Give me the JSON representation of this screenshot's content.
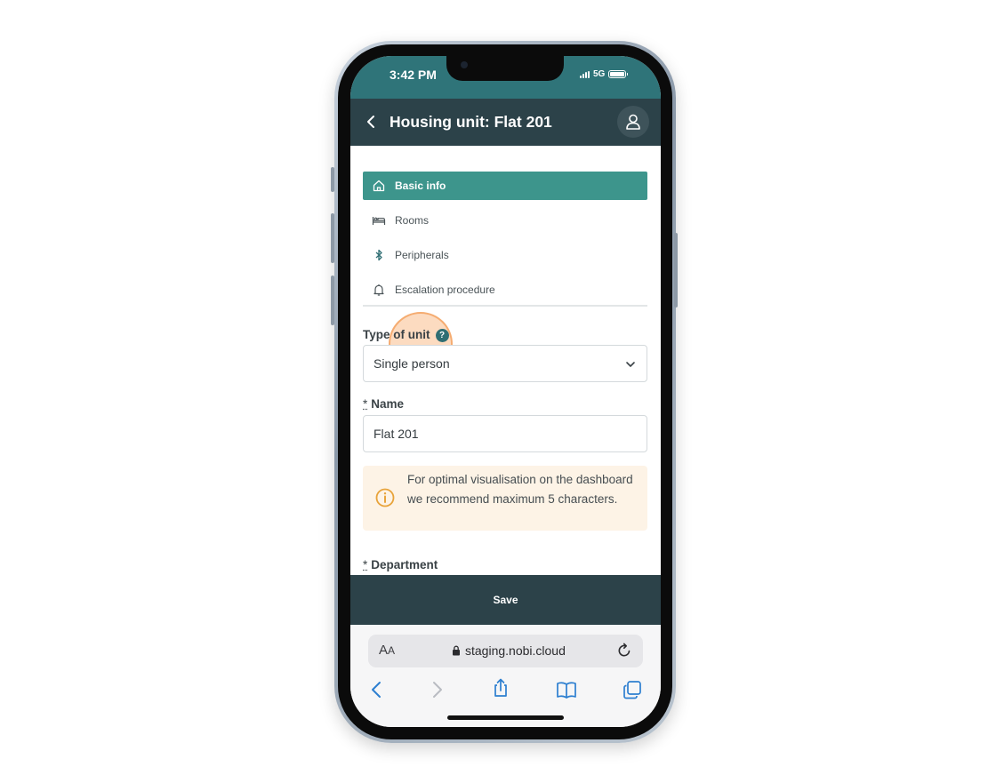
{
  "status_bar": {
    "time": "3:42 PM",
    "network": "5G"
  },
  "header": {
    "title": "Housing unit: Flat 201"
  },
  "nav": {
    "items": [
      {
        "label": "Basic info",
        "icon": "home-icon",
        "active": true
      },
      {
        "label": "Rooms",
        "icon": "bed-icon",
        "active": false
      },
      {
        "label": "Peripherals",
        "icon": "bluetooth-icon",
        "active": false
      },
      {
        "label": "Escalation procedure",
        "icon": "bell-icon",
        "active": false
      }
    ]
  },
  "form": {
    "type_of_unit": {
      "label": "Type of unit",
      "help": "?",
      "value": "Single person"
    },
    "name": {
      "required_marker": "*",
      "label": "Name",
      "value": "Flat 201"
    },
    "info_message": "For optimal visualisation on the dashboard we recommend maximum 5 characters.",
    "department": {
      "required_marker": "*",
      "label": "Department"
    }
  },
  "save_label": "Save",
  "browser": {
    "aa": "A",
    "aa_small": "A",
    "url": "staging.nobi.cloud"
  },
  "colors": {
    "header_bg": "#2c4249",
    "status_bg": "#2f7479",
    "active_nav": "#3d958c",
    "info_bg": "#fdf3e6",
    "info_icon": "#e8a33a",
    "highlight": "#f5a564"
  }
}
